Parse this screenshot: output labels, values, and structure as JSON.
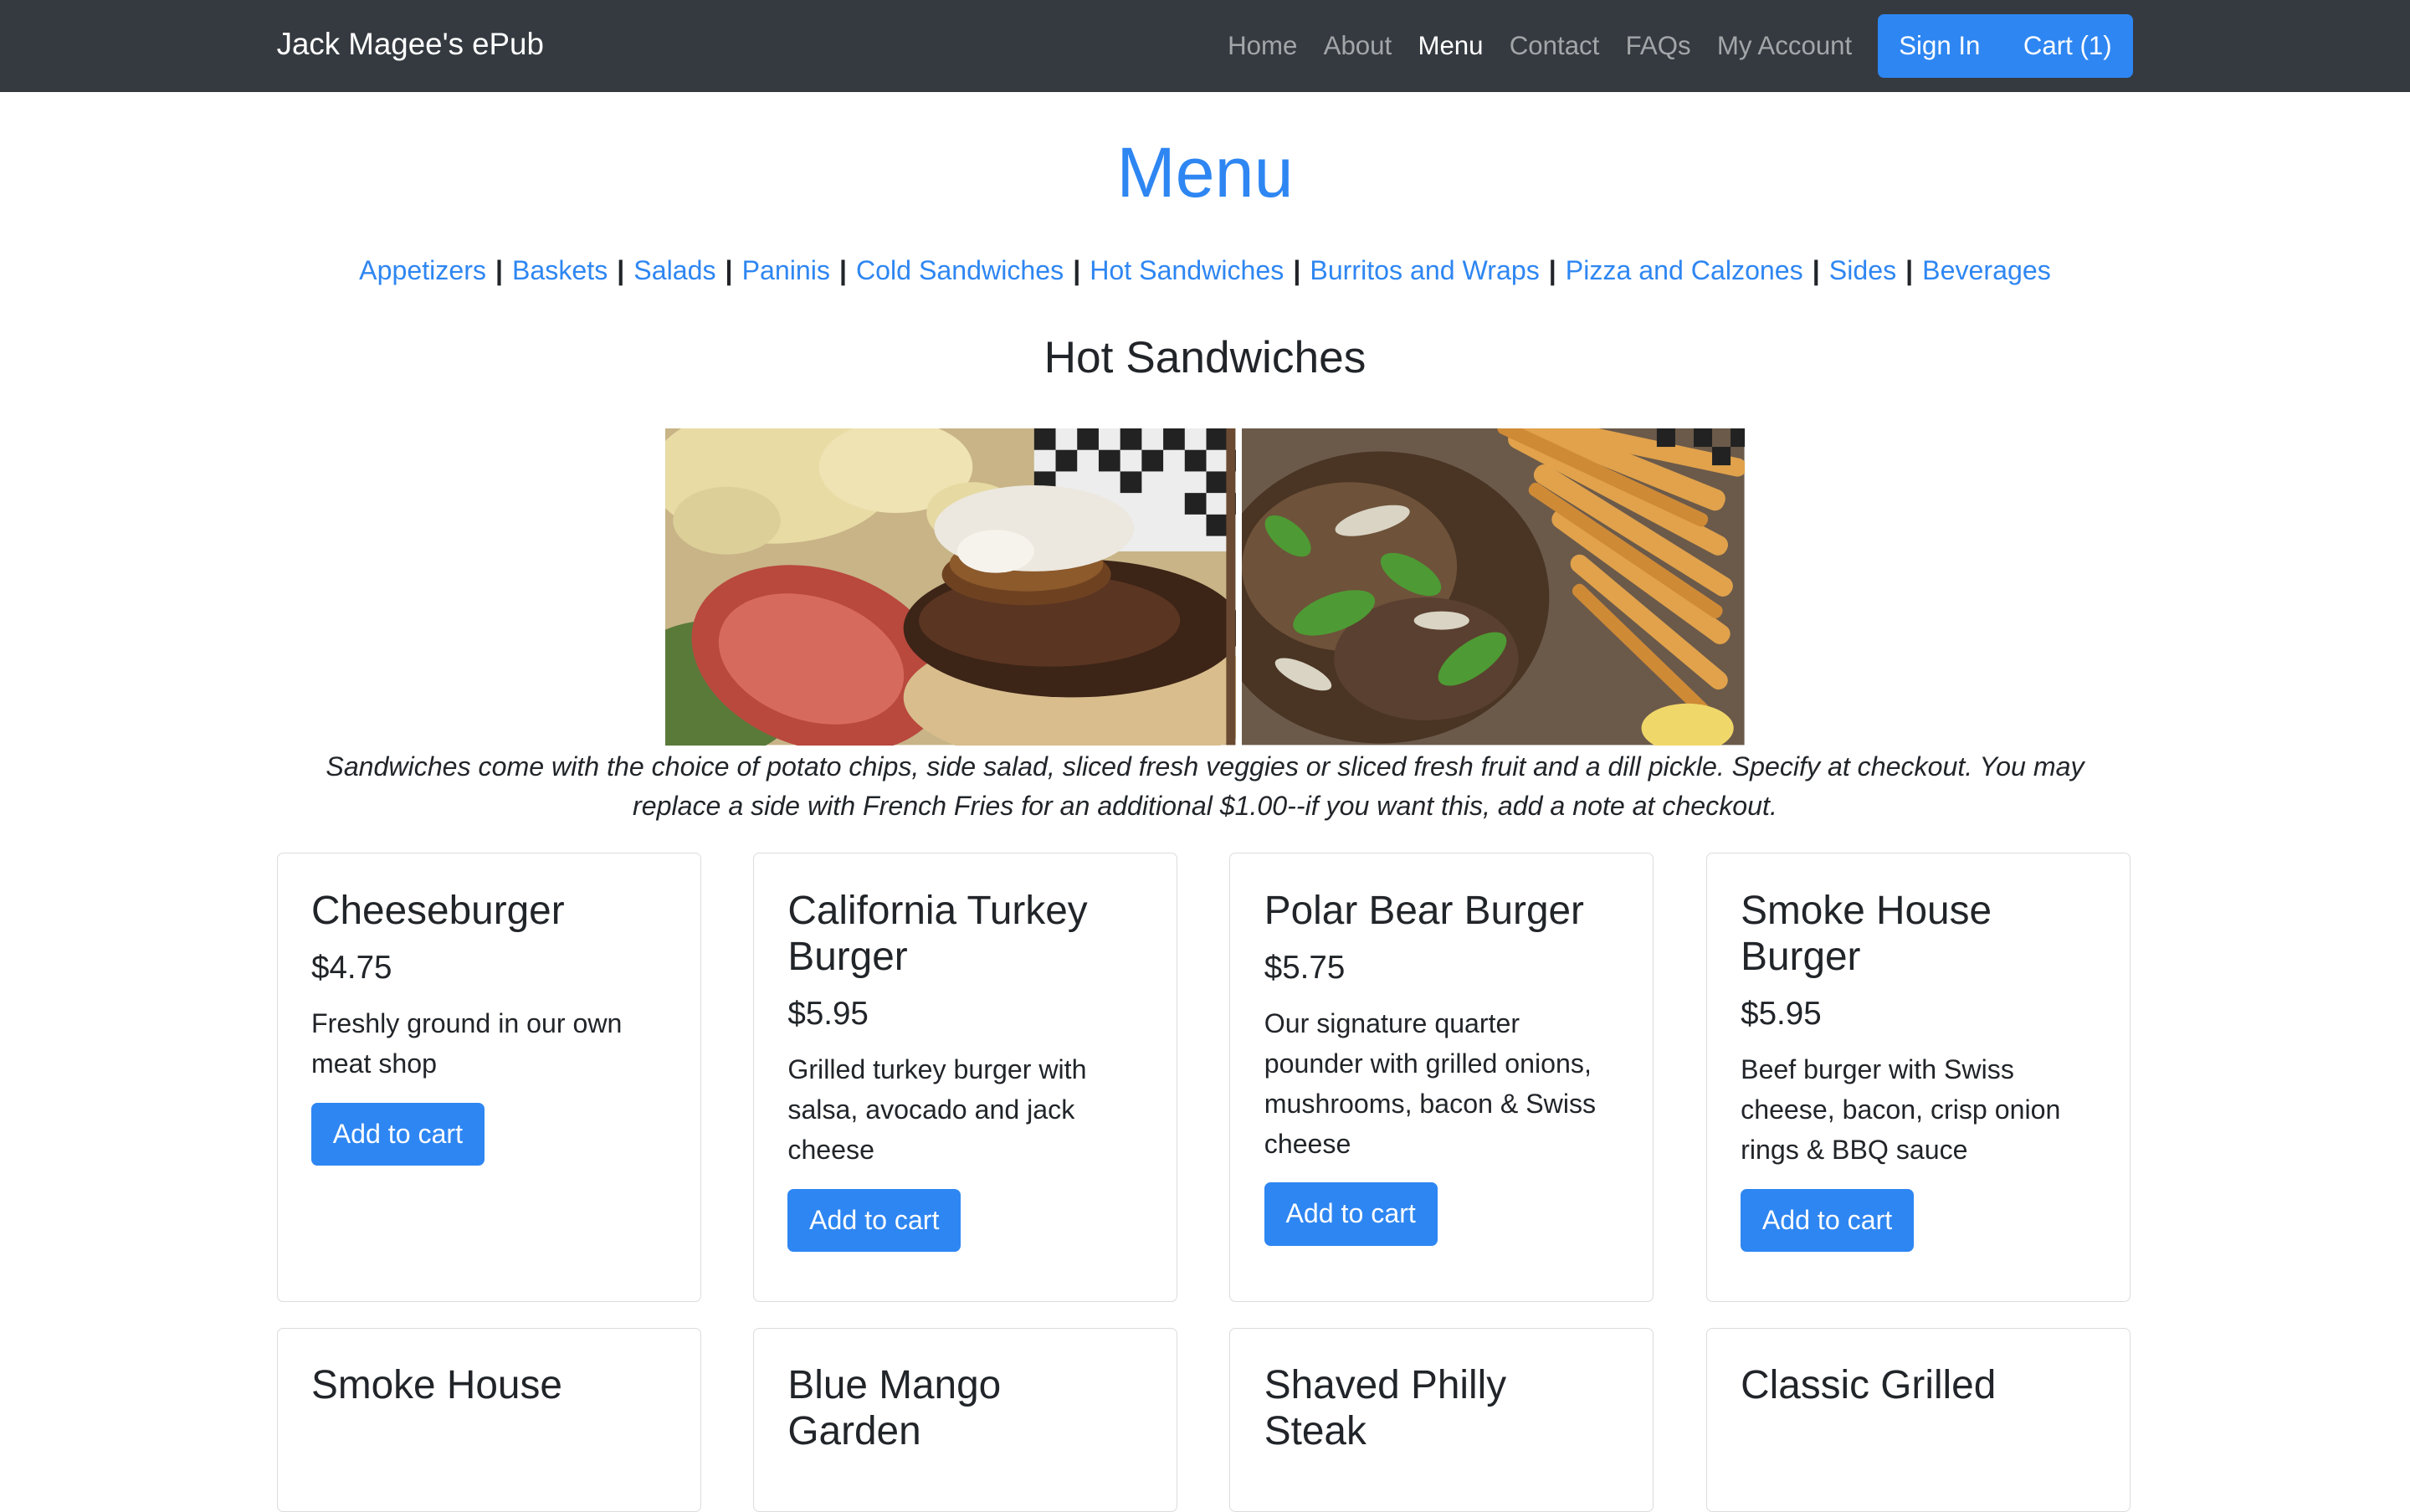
{
  "navbar": {
    "brand": "Jack Magee's ePub",
    "links": [
      "Home",
      "About",
      "Menu",
      "Contact",
      "FAQs",
      "My Account"
    ],
    "active": "Menu",
    "sign_in": "Sign In",
    "cart": "Cart (1)"
  },
  "page": {
    "title": "Menu",
    "categories": [
      "Appetizers",
      "Baskets",
      "Salads",
      "Paninis",
      "Cold Sandwiches",
      "Hot Sandwiches",
      "Burritos and Wraps",
      "Pizza and Calzones",
      "Sides",
      "Beverages"
    ],
    "category_separator": "|",
    "section_title": "Hot Sandwiches",
    "note": "Sandwiches come with the choice of potato chips, side salad, sliced fresh veggies or sliced fresh fruit and a dill pickle. Specify at checkout. You may replace a side with French Fries for an additional $1.00--if you want this, add a note at checkout."
  },
  "items": [
    {
      "name": "Cheeseburger",
      "price": "$4.75",
      "desc": "Freshly ground in our own meat shop",
      "button": "Add to cart"
    },
    {
      "name": "California Turkey Burger",
      "price": "$5.95",
      "desc": "Grilled turkey burger with salsa, avocado and jack cheese",
      "button": "Add to cart"
    },
    {
      "name": "Polar Bear Burger",
      "price": "$5.75",
      "desc": "Our signature quarter pounder with grilled onions, mushrooms, bacon & Swiss cheese",
      "button": "Add to cart"
    },
    {
      "name": "Smoke House Burger",
      "price": "$5.95",
      "desc": "Beef burger with Swiss cheese, bacon, crisp onion rings & BBQ sauce",
      "button": "Add to cart"
    },
    {
      "name": "Smoke House",
      "price": "",
      "desc": "",
      "button": ""
    },
    {
      "name": "Blue Mango Garden",
      "price": "",
      "desc": "",
      "button": ""
    },
    {
      "name": "Shaved Philly Steak",
      "price": "",
      "desc": "",
      "button": ""
    },
    {
      "name": "Classic Grilled",
      "price": "",
      "desc": "",
      "button": ""
    }
  ],
  "colors": {
    "navbar": "#343a40",
    "accent": "#2e86f2",
    "text": "#212529"
  }
}
